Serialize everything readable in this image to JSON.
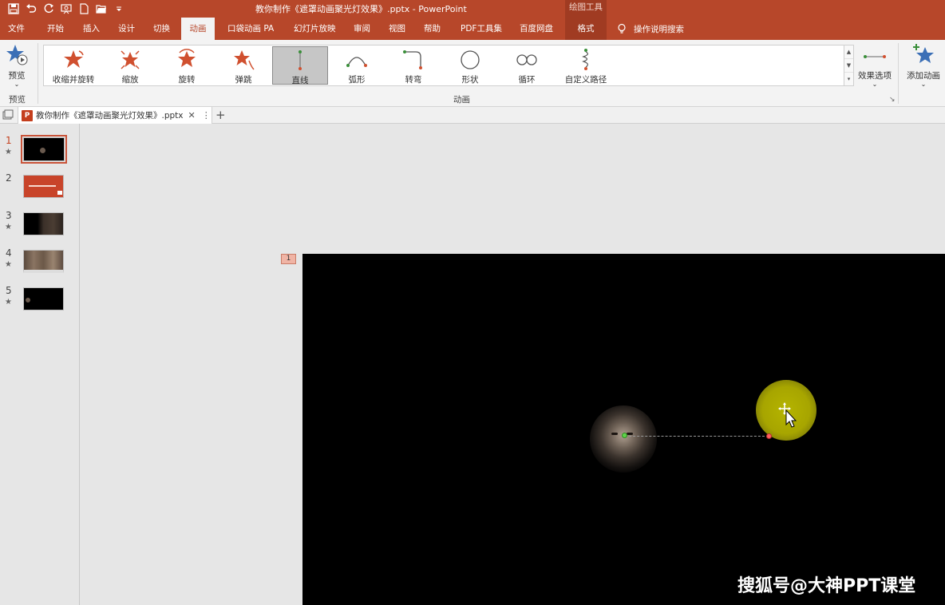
{
  "window": {
    "title": "教你制作《遮罩动画聚光灯效果》.pptx - PowerPoint",
    "context_group": "绘图工具"
  },
  "quick_access": [
    {
      "icon": "save-icon"
    },
    {
      "icon": "undo-icon"
    },
    {
      "icon": "redo-icon"
    },
    {
      "icon": "slideshow-icon"
    },
    {
      "icon": "new-file-icon"
    },
    {
      "icon": "open-folder-icon"
    },
    {
      "icon": "customize-icon"
    }
  ],
  "tabs": [
    {
      "label": "文件"
    },
    {
      "label": "开始"
    },
    {
      "label": "插入"
    },
    {
      "label": "设计"
    },
    {
      "label": "切换"
    },
    {
      "label": "动画",
      "active": true
    },
    {
      "label": "口袋动画 PA"
    },
    {
      "label": "幻灯片放映"
    },
    {
      "label": "审阅"
    },
    {
      "label": "视图"
    },
    {
      "label": "帮助"
    },
    {
      "label": "PDF工具集"
    },
    {
      "label": "百度网盘"
    },
    {
      "label": "格式",
      "context": true
    }
  ],
  "tell_me": "操作说明搜索",
  "ribbon": {
    "preview": {
      "label": "预览",
      "group": "预览"
    },
    "animation_group": "动画",
    "gallery": [
      {
        "label": "收缩并旋转",
        "icon": "shrink-turn-star-icon"
      },
      {
        "label": "缩放",
        "icon": "zoom-star-icon"
      },
      {
        "label": "旋转",
        "icon": "spin-star-icon"
      },
      {
        "label": "弹跳",
        "icon": "bounce-star-icon"
      },
      {
        "label": "直线",
        "icon": "line-path-icon",
        "selected": true
      },
      {
        "label": "弧形",
        "icon": "arc-path-icon"
      },
      {
        "label": "转弯",
        "icon": "turn-path-icon"
      },
      {
        "label": "形状",
        "icon": "shape-path-icon"
      },
      {
        "label": "循环",
        "icon": "loop-path-icon"
      },
      {
        "label": "自定义路径",
        "icon": "custom-path-icon"
      }
    ],
    "effect_options": "效果选项",
    "add_animation": "添加动画"
  },
  "document_tab": {
    "name": "教你制作《遮罩动画聚光灯效果》.pptx",
    "close": "✕",
    "more": "⋮",
    "add": "+"
  },
  "thumbnails": [
    {
      "number": "1",
      "star": "★",
      "active": true
    },
    {
      "number": "2",
      "star": ""
    },
    {
      "number": "3",
      "star": "★"
    },
    {
      "number": "4",
      "star": "★"
    },
    {
      "number": "5",
      "star": "★"
    }
  ],
  "slide": {
    "animation_tag": "1"
  },
  "watermark": "搜狐号@大神PPT课堂",
  "colors": {
    "accent": "#b7472a",
    "spotlight": "#a9a800",
    "path_start": "#5fd34b",
    "path_end": "#ff5f5f"
  }
}
